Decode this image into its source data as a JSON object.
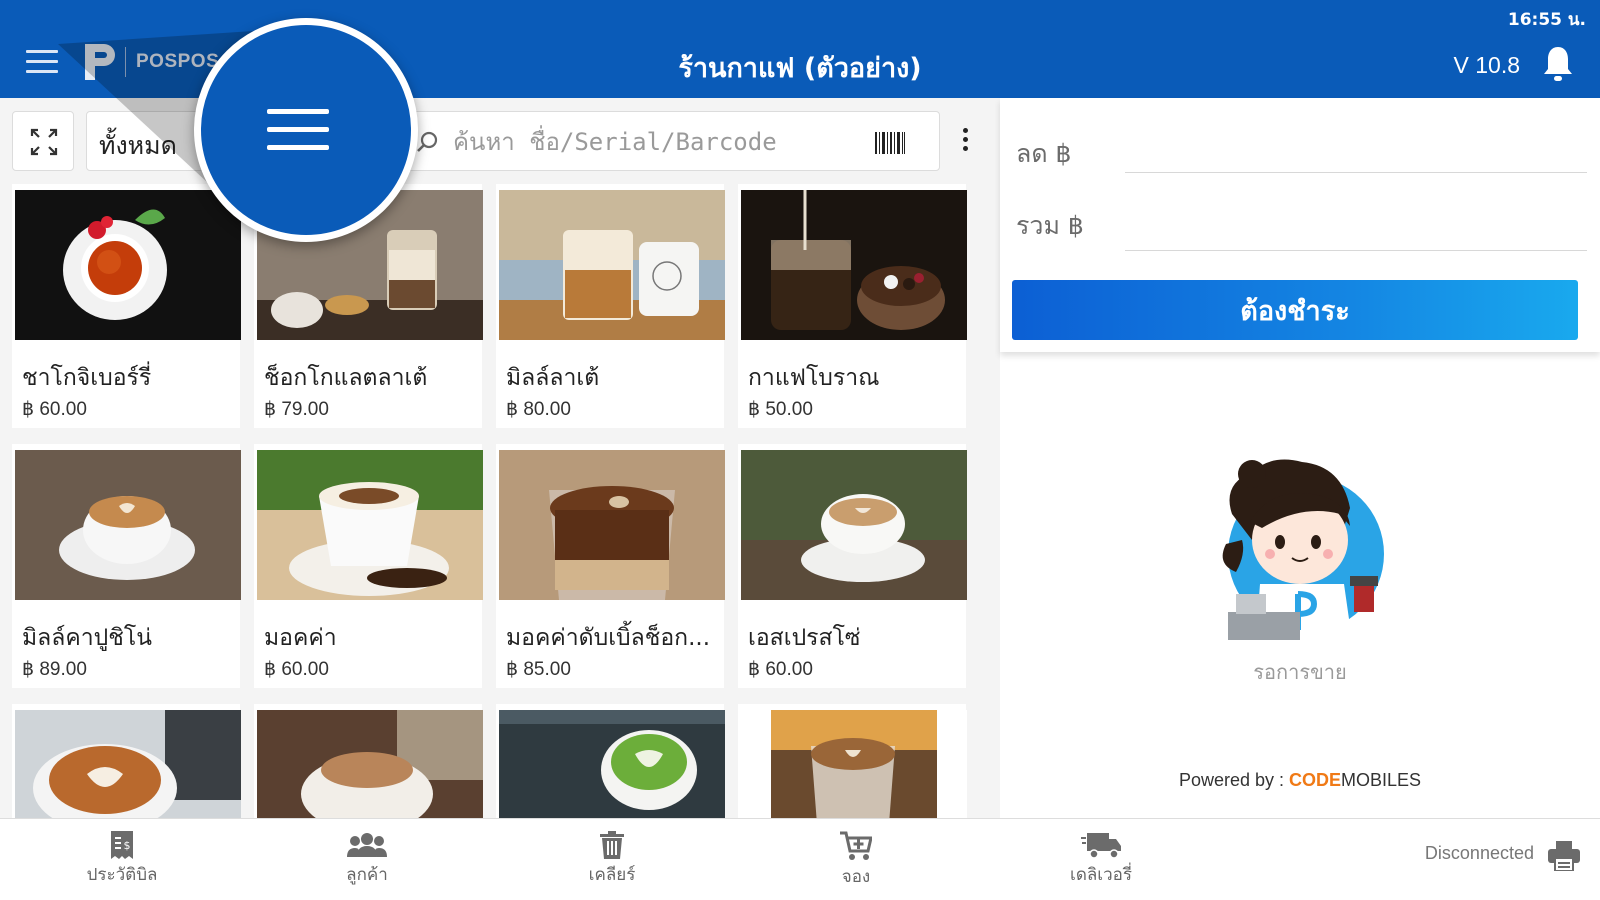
{
  "status_bar": {
    "time": "16:55 น."
  },
  "header": {
    "logo_text": "POSPOS",
    "title": "ร้านกาแฟ (ตัวอย่าง)",
    "version": "V 10.8",
    "brand_color": "#0a5bb8"
  },
  "toolbar": {
    "category": "ทั้งหมด",
    "search_placeholder": "ค้นหา ชื่อ/Serial/Barcode"
  },
  "products": [
    {
      "name": "ชาโกจิเบอร์รี่",
      "price": "฿ 60.00"
    },
    {
      "name": "ช็อกโกแลตลาเต้",
      "price": "฿ 79.00"
    },
    {
      "name": "มิลล์ลาเต้",
      "price": "฿ 80.00"
    },
    {
      "name": "กาแฟโบราณ",
      "price": "฿ 50.00"
    },
    {
      "name": "มิลล์คาปูชิโน่",
      "price": "฿ 89.00"
    },
    {
      "name": "มอคค่า",
      "price": "฿ 60.00"
    },
    {
      "name": "มอคค่าดับเบิ้ลช็อก...",
      "price": "฿ 85.00"
    },
    {
      "name": "เอสเปรสโซ่",
      "price": "฿ 60.00"
    },
    {
      "name": "",
      "price": ""
    },
    {
      "name": "",
      "price": ""
    },
    {
      "name": "",
      "price": ""
    },
    {
      "name": "",
      "price": ""
    }
  ],
  "summary": {
    "discount_label": "ลด ฿",
    "total_label": "รวม ฿",
    "pay_button": "ต้องชำระ"
  },
  "empty_state": {
    "text": "รอการขาย"
  },
  "powered": {
    "prefix": "Powered by : ",
    "brand1": "CODE",
    "brand2": "MOBILES"
  },
  "bottom_nav": {
    "items": [
      {
        "label": "ประวัติบิล",
        "icon": "receipt-icon"
      },
      {
        "label": "ลูกค้า",
        "icon": "customers-icon"
      },
      {
        "label": "เคลียร์",
        "icon": "trash-icon"
      },
      {
        "label": "จอง",
        "icon": "cart-add-icon"
      },
      {
        "label": "เดลิเวอรี่",
        "icon": "delivery-truck-icon"
      }
    ],
    "printer_status": "Disconnected"
  }
}
